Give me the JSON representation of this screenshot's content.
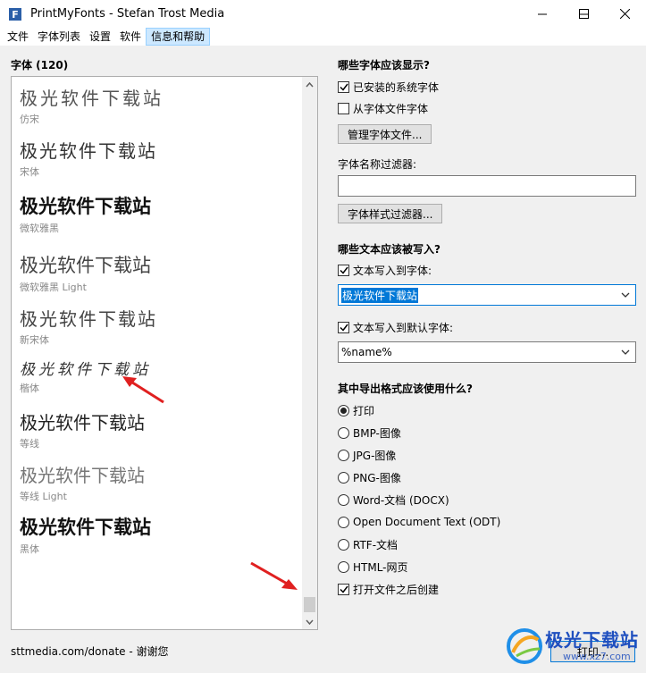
{
  "window": {
    "title": "PrintMyFonts - Stefan Trost Media"
  },
  "menu": [
    "文件",
    "字体列表",
    "设置",
    "软件",
    "信息和帮助"
  ],
  "fonts_panel": {
    "header": "字体 (120)",
    "entries": [
      {
        "sample": "极光软件下载站",
        "name": "仿宋"
      },
      {
        "sample": "极光软件下载站",
        "name": "宋体"
      },
      {
        "sample": "极光软件下载站",
        "name": "微软雅黑"
      },
      {
        "sample": "极光软件下载站",
        "name": "微软雅黑 Light"
      },
      {
        "sample": "极光软件下载站",
        "name": "新宋体"
      },
      {
        "sample": "极光软件下载站",
        "name": "楷体"
      },
      {
        "sample": "极光软件下载站",
        "name": "等线"
      },
      {
        "sample": "极光软件下载站",
        "name": "等线 Light"
      },
      {
        "sample": "极光软件下载站",
        "name": "黑体"
      }
    ]
  },
  "options": {
    "show_section_title": "哪些字体应该显示?",
    "installed_fonts": {
      "label": "已安装的系统字体",
      "checked": true
    },
    "from_files": {
      "label": "从字体文件字体",
      "checked": false
    },
    "manage_button": "管理字体文件...",
    "name_filter_label": "字体名称过滤器:",
    "name_filter_value": "",
    "style_filter_button": "字体样式过滤器...",
    "text_section_title": "哪些文本应该被写入?",
    "write_to_font": {
      "label": "文本写入到字体:",
      "checked": true
    },
    "write_to_font_value": "极光软件下载站",
    "write_to_default": {
      "label": "文本写入到默认字体:",
      "checked": true
    },
    "write_to_default_value": "%name%",
    "format_section_title": "其中导出格式应该使用什么?",
    "formats": [
      {
        "label": "打印",
        "selected": true
      },
      {
        "label": "BMP-图像",
        "selected": false
      },
      {
        "label": "JPG-图像",
        "selected": false
      },
      {
        "label": "PNG-图像",
        "selected": false
      },
      {
        "label": "Word-文档 (DOCX)",
        "selected": false
      },
      {
        "label": "Open Document Text (ODT)",
        "selected": false
      },
      {
        "label": "RTF-文档",
        "selected": false
      },
      {
        "label": "HTML-网页",
        "selected": false
      }
    ],
    "open_after": {
      "label": "打开文件之后创建",
      "checked": true
    }
  },
  "footer": {
    "donate_text": "sttmedia.com/donate - 谢谢您",
    "print_button": "打印..."
  },
  "watermark": {
    "text": "极光下载站",
    "sub": "www.xz7.com"
  },
  "colors": {
    "accent": "#0078d7",
    "arrow": "#e02020"
  }
}
